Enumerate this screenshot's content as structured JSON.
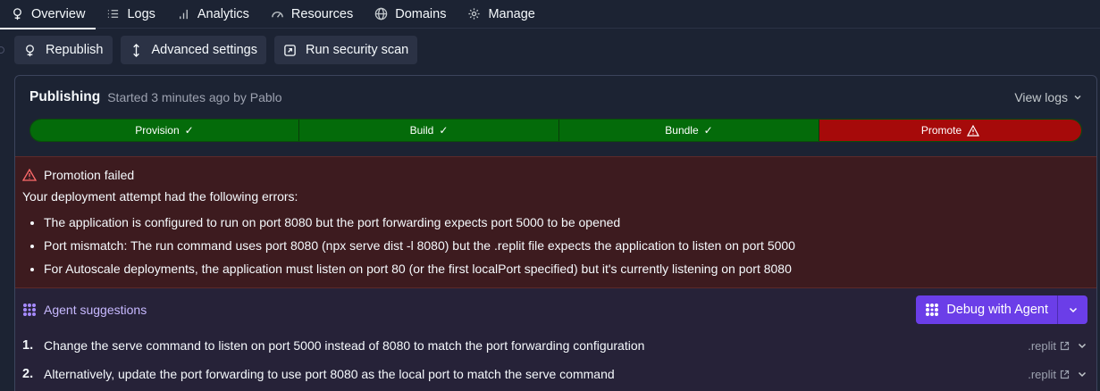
{
  "tabs": [
    {
      "label": "Overview",
      "icon": "deploy-icon",
      "active": true
    },
    {
      "label": "Logs",
      "icon": "list-icon"
    },
    {
      "label": "Analytics",
      "icon": "bar-chart-icon"
    },
    {
      "label": "Resources",
      "icon": "gauge-icon"
    },
    {
      "label": "Domains",
      "icon": "globe-icon"
    },
    {
      "label": "Manage",
      "icon": "gear-icon"
    }
  ],
  "actions": {
    "republish": "Republish",
    "advanced": "Advanced settings",
    "security": "Run security scan"
  },
  "publishing": {
    "title": "Publishing",
    "subtitle": "Started 3 minutes ago by Pablo",
    "view_logs": "View logs",
    "stages": [
      {
        "label": "Provision",
        "status": "success"
      },
      {
        "label": "Build",
        "status": "success"
      },
      {
        "label": "Bundle",
        "status": "success"
      },
      {
        "label": "Promote",
        "status": "failed"
      }
    ]
  },
  "error": {
    "title": "Promotion failed",
    "intro": "Your deployment attempt had the following errors:",
    "items": [
      "The application is configured to run on port 8080 but the port forwarding expects port 5000 to be opened",
      "Port mismatch: The run command uses port 8080 (npx serve dist -l 8080) but the .replit file expects the application to listen on port 5000",
      "For Autoscale deployments, the application must listen on port 80 (or the first localPort specified) but it's currently listening on port 8080"
    ]
  },
  "agent": {
    "title": "Agent suggestions",
    "debug_label": "Debug with Agent",
    "suggestions": [
      {
        "num": "1.",
        "text": "Change the serve command to listen on port 5000 instead of 8080 to match the port forwarding configuration",
        "file": ".replit"
      },
      {
        "num": "2.",
        "text": "Alternatively, update the port forwarding to use port 8080 as the local port to match the serve command",
        "file": ".replit"
      }
    ]
  },
  "colors": {
    "success": "#046b0a",
    "failed": "#a60a0a",
    "agent_accent": "#6b3ee8"
  }
}
